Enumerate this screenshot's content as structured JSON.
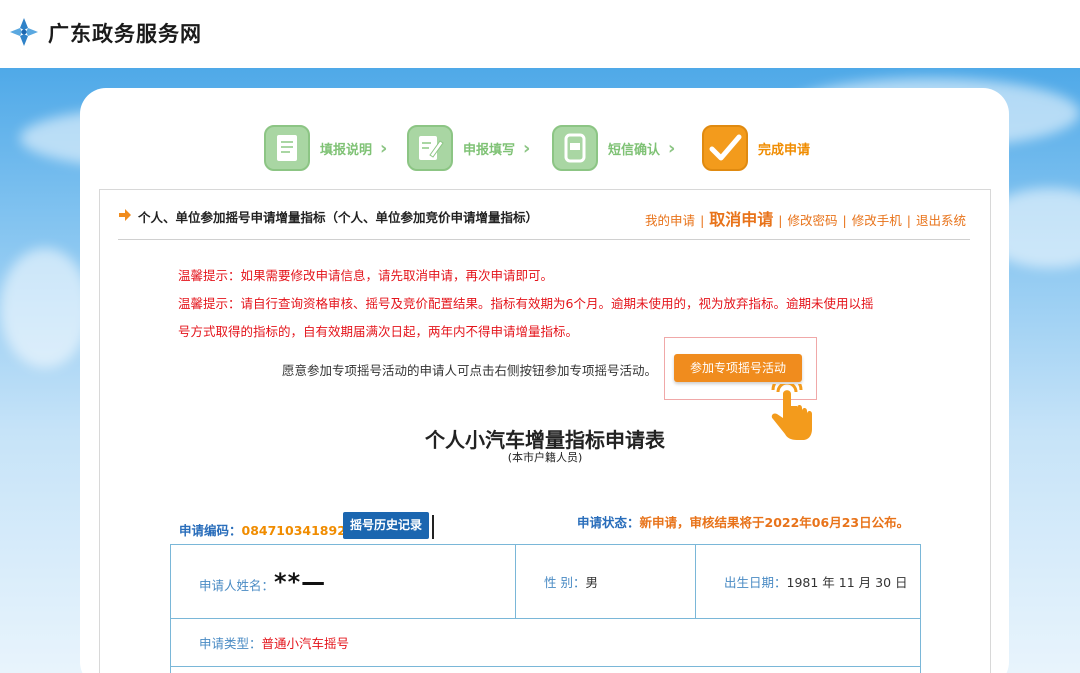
{
  "site": {
    "title": "广东政务服务网"
  },
  "steps": [
    {
      "label": "填报说明",
      "icon": "document-icon",
      "active": false
    },
    {
      "label": "申报填写",
      "icon": "edit-form-icon",
      "active": false
    },
    {
      "label": "短信确认",
      "icon": "phone-icon",
      "active": false
    },
    {
      "label": "完成申请",
      "icon": "checkmark-icon",
      "active": true
    }
  ],
  "header": {
    "title": "个人、单位参加摇号申请增量指标（个人、单位参加竞价申请增量指标）",
    "nav": {
      "my_application": "我的申请",
      "cancel_application": "取消申请",
      "change_password": "修改密码",
      "change_phone": "修改手机",
      "logout": "退出系统",
      "separator": "|"
    }
  },
  "tips": {
    "tip1": "温馨提示：如果需要修改申请信息，请先取消申请，再次申请即可。",
    "tip2": "温馨提示：请自行查询资格审核、摇号及竞价配置结果。指标有效期为6个月。逾期未使用的，视为放弃指标。逾期未使用以摇",
    "tip3": "号方式取得的指标的，自有效期届满次日起，两年内不得申请增量指标。"
  },
  "special": {
    "note": "愿意参加专项摇号活动的申请人可点击右侧按钮参加专项摇号活动。",
    "button": "参加专项摇号活动"
  },
  "form": {
    "title": "个人小汽车增量指标申请表",
    "subtitle": "(本市户籍人员)",
    "code_label": "申请编码：",
    "code_value": "0847103418922",
    "history_button": "摇号历史记录",
    "status_label": "申请状态：",
    "status_value": "新申请，审核结果将于2022年06月23日公布。",
    "applicant_label": "申请人姓名：",
    "applicant_value": "**—",
    "gender_label": "性 别：",
    "gender_value": "男",
    "birth_label": "出生日期：",
    "birth_value": "1981 年 11 月 30 日",
    "type_label": "申请类型：",
    "type_value": "普通小汽车摇号"
  },
  "colors": {
    "accent_orange": "#f08c1e",
    "link_blue": "#2a6ebb",
    "tip_red": "#e4141b",
    "step_green": "#a9d6a3"
  }
}
